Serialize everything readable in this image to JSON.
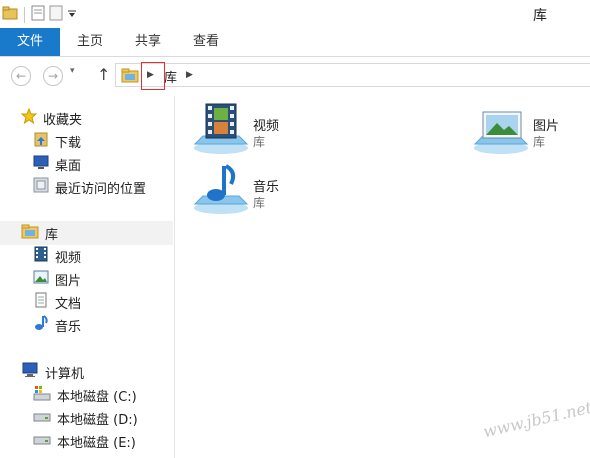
{
  "window": {
    "title": "库"
  },
  "ribbon": {
    "tabs": [
      "文件",
      "主页",
      "共享",
      "查看"
    ]
  },
  "address": {
    "path": [
      "库"
    ]
  },
  "navpane": {
    "favorites": {
      "label": "收藏夹",
      "items": [
        "下载",
        "桌面",
        "最近访问的位置"
      ]
    },
    "libraries": {
      "label": "库",
      "items": [
        "视频",
        "图片",
        "文档",
        "音乐"
      ]
    },
    "computer": {
      "label": "计算机",
      "items": [
        "本地磁盘 (C:)",
        "本地磁盘 (D:)",
        "本地磁盘 (E:)"
      ]
    }
  },
  "content": {
    "items": [
      {
        "name": "视频",
        "type": "库",
        "icon": "video-library-icon"
      },
      {
        "name": "图片",
        "type": "库",
        "icon": "pictures-library-icon"
      },
      {
        "name": "音乐",
        "type": "库",
        "icon": "music-library-icon"
      }
    ]
  },
  "watermark": "www.jb51.net",
  "colors": {
    "file_tab": "#1979ca",
    "highlight_box": "#e03030"
  }
}
